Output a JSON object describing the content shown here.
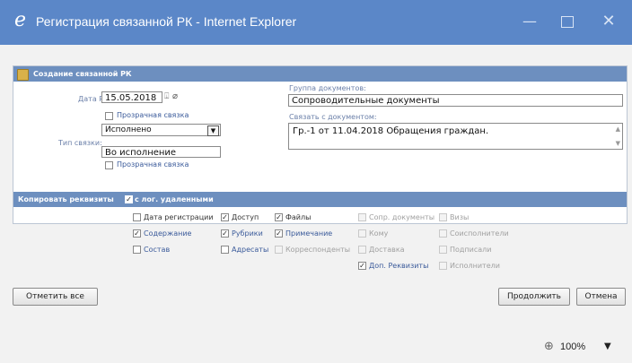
{
  "window": {
    "title": "Регистрация связанной РК - Internet Explorer",
    "app_icon": "ie-logo-icon",
    "minimize_icon": "—",
    "close_icon": "✕"
  },
  "header": {
    "title": "Создание связанной РК"
  },
  "form": {
    "date_label": "Дата РК:",
    "date_value": "15.05.2018",
    "transparent_link_label_1": "Прозрачная связка",
    "transparent_link_label_2": "Прозрачная связка",
    "link_type_label": "Тип связки:",
    "link_type_selected": "Исполнено",
    "link_type_text": "Во исполнение",
    "doc_group_label": "Группа документов:",
    "doc_group_value": "Сопроводительные документы",
    "link_doc_label": "Связать с документом:",
    "link_doc_value": "Гр.-1 от 11.04.2018 Обращения граждан."
  },
  "copy": {
    "title": "Копировать реквизиты",
    "with_deleted_label": "с лог. удаленными",
    "with_deleted_checked": true,
    "items": [
      {
        "label": "Дата регистрации",
        "checked": false,
        "enabled": true
      },
      {
        "label": "Доступ",
        "checked": true,
        "enabled": true
      },
      {
        "label": "Файлы",
        "checked": true,
        "enabled": true
      },
      {
        "label": "Сопр. документы",
        "checked": false,
        "enabled": false
      },
      {
        "label": "Визы",
        "checked": false,
        "enabled": false
      },
      {
        "label": "Содержание",
        "checked": true,
        "enabled": true
      },
      {
        "label": "Рубрики",
        "checked": true,
        "enabled": true
      },
      {
        "label": "Примечание",
        "checked": true,
        "enabled": true
      },
      {
        "label": "Кому",
        "checked": false,
        "enabled": false
      },
      {
        "label": "Соисполнители",
        "checked": false,
        "enabled": false
      },
      {
        "label": "Состав",
        "checked": false,
        "enabled": true
      },
      {
        "label": "Адресаты",
        "checked": false,
        "enabled": true
      },
      {
        "label": "Корреспонденты",
        "checked": false,
        "enabled": false
      },
      {
        "label": "Доставка",
        "checked": false,
        "enabled": false
      },
      {
        "label": "Подписали",
        "checked": false,
        "enabled": false
      },
      {
        "label": "Доп. Реквизиты",
        "checked": true,
        "enabled": true
      },
      {
        "label": "Исполнители",
        "checked": false,
        "enabled": false
      }
    ]
  },
  "buttons": {
    "uncheck_all": "Отметить все",
    "continue": "Продолжить",
    "cancel": "Отмена"
  },
  "status": {
    "zoom": "100%",
    "dropdown": "▼"
  },
  "colors": {
    "titlebar": "#5b87c8",
    "panel_header": "#6d8fbf"
  }
}
